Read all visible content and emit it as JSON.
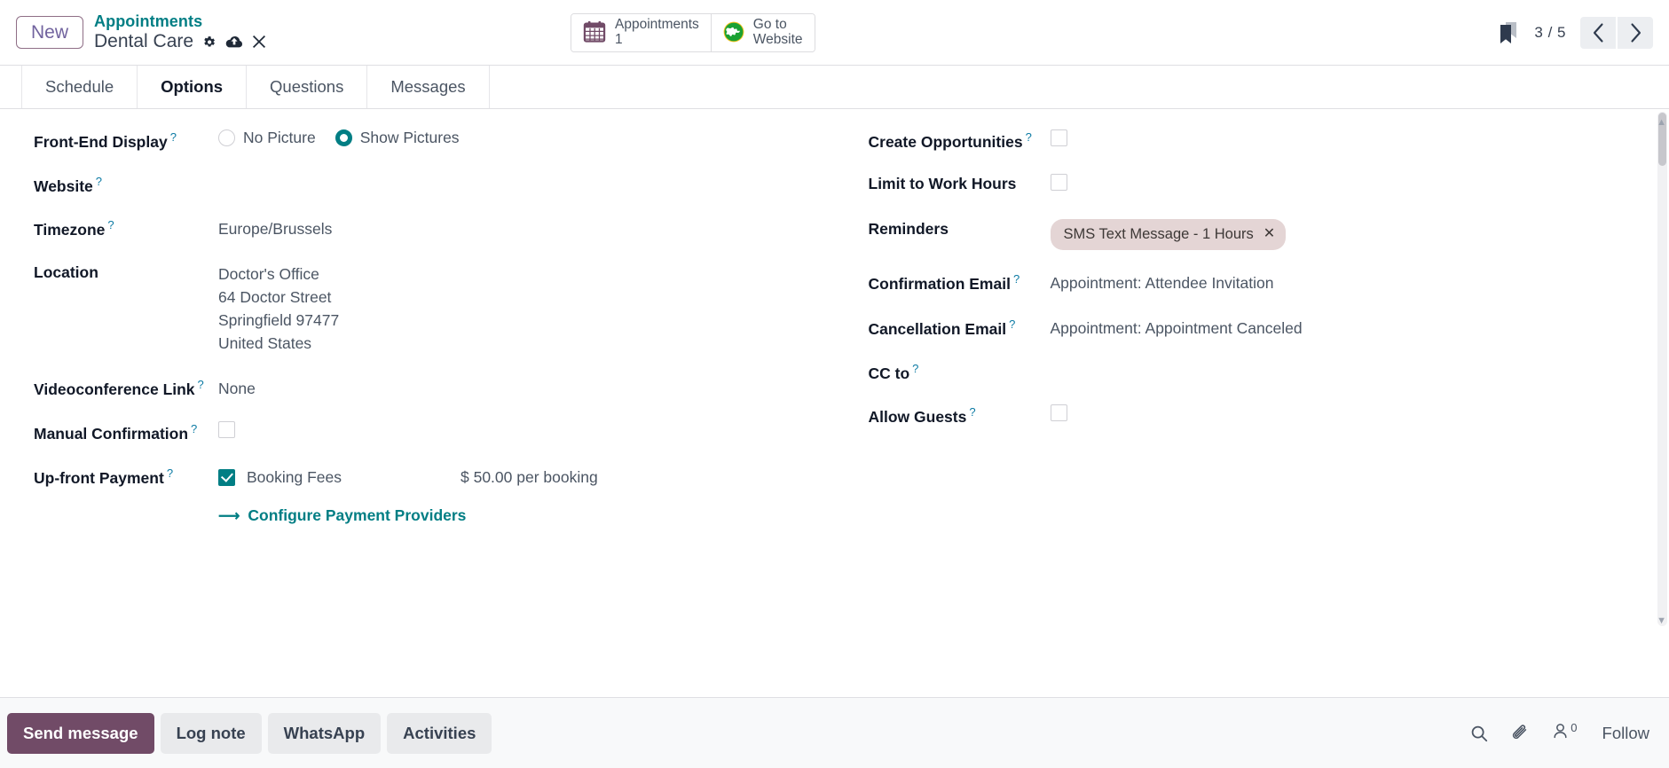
{
  "header": {
    "new_button": "New",
    "breadcrumb_parent": "Appointments",
    "breadcrumb_current": "Dental Care",
    "gear_icon": "gear-icon",
    "cloud_upload_icon": "cloud-upload-icon",
    "discard_icon": "close-icon",
    "stat_buttons": [
      {
        "icon": "calendar-icon",
        "label": "Appointments",
        "value": "1"
      },
      {
        "icon": "globe-icon",
        "label": "Go to",
        "value": "Website"
      }
    ],
    "bookmark_icon": "bookmark-icon",
    "pager": "3 / 5",
    "prev_icon": "chevron-left-icon",
    "next_icon": "chevron-right-icon"
  },
  "tabs": [
    {
      "label": "Schedule",
      "active": false
    },
    {
      "label": "Options",
      "active": true
    },
    {
      "label": "Questions",
      "active": false
    },
    {
      "label": "Messages",
      "active": false
    }
  ],
  "form": {
    "left": {
      "front_end_display": {
        "label": "Front-End Display",
        "tip": "?",
        "options": [
          {
            "label": "No Picture",
            "selected": false
          },
          {
            "label": "Show Pictures",
            "selected": true
          }
        ]
      },
      "website": {
        "label": "Website",
        "tip": "?",
        "value": ""
      },
      "timezone": {
        "label": "Timezone",
        "tip": "?",
        "value": "Europe/Brussels"
      },
      "location": {
        "label": "Location",
        "lines": [
          "Doctor's Office",
          "64 Doctor Street",
          "Springfield 97477",
          "United States"
        ]
      },
      "videoconference_link": {
        "label": "Videoconference Link",
        "tip": "?",
        "value": "None"
      },
      "manual_confirmation": {
        "label": "Manual Confirmation",
        "tip": "?",
        "checked": false
      },
      "upfront_payment": {
        "label": "Up-front Payment",
        "tip": "?",
        "checkbox_label": "Booking Fees",
        "checked": true,
        "amount": "$ 50.00 per booking",
        "configure_link": "Configure Payment Providers",
        "arrow_icon": "arrow-right-icon"
      }
    },
    "right": {
      "create_opportunities": {
        "label": "Create Opportunities",
        "tip": "?",
        "checked": false
      },
      "limit_to_work_hours": {
        "label": "Limit to Work Hours",
        "checked": false
      },
      "reminders": {
        "label": "Reminders",
        "tags": [
          "SMS Text Message - 1 Hours"
        ],
        "remove_icon": "close-icon"
      },
      "confirmation_email": {
        "label": "Confirmation Email",
        "tip": "?",
        "value": "Appointment: Attendee Invitation"
      },
      "cancellation_email": {
        "label": "Cancellation Email",
        "tip": "?",
        "value": "Appointment: Appointment Canceled"
      },
      "cc_to": {
        "label": "CC to",
        "tip": "?",
        "value": ""
      },
      "allow_guests": {
        "label": "Allow Guests",
        "tip": "?",
        "checked": false
      }
    }
  },
  "chatter": {
    "buttons": [
      {
        "label": "Send message",
        "primary": true
      },
      {
        "label": "Log note",
        "primary": false
      },
      {
        "label": "WhatsApp",
        "primary": false
      },
      {
        "label": "Activities",
        "primary": false
      }
    ],
    "search_icon": "search-icon",
    "attachment_icon": "paperclip-icon",
    "followers_icon": "user-icon",
    "followers_count": "0",
    "follow_label": "Follow"
  },
  "colors": {
    "accent_teal": "#017e84",
    "primary_purple": "#714b67",
    "tip_blue": "#0d7ba4",
    "chip_bg": "#e4d5d5"
  }
}
